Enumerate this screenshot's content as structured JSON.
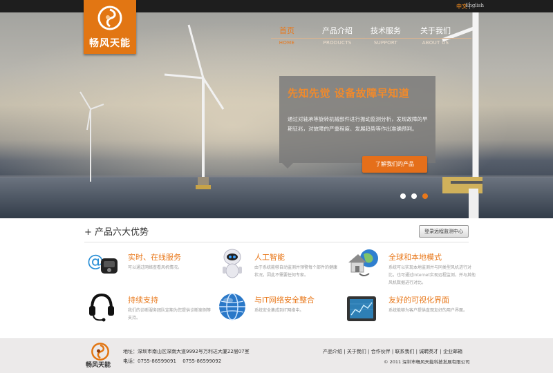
{
  "language": {
    "cn": "中文",
    "en": "English"
  },
  "logo": {
    "text": "畅风天能"
  },
  "nav": [
    {
      "cn": "首页",
      "en": "HOME",
      "active": true
    },
    {
      "cn": "产品介绍",
      "en": "PRODUCTS",
      "active": false
    },
    {
      "cn": "技术服务",
      "en": "SUPPORT",
      "active": false
    },
    {
      "cn": "关于我们",
      "en": "ABOUT US",
      "active": false
    }
  ],
  "banner": {
    "title": "先知先觉  设备故障早知道",
    "body": "通过对轴承等旋转机械部件进行振动监测分析，发现故障的早期征兆，对故障的严重程度、发展趋势等作出准确预判。",
    "button": "了解我们的产品",
    "slides_count": 3,
    "active_slide": 3
  },
  "advantages": {
    "heading": "+ 产品六大优势",
    "login_button": "登录远程监测中心",
    "items": [
      {
        "icon": "phone-at-icon",
        "title": "实时、在线服务",
        "desc": "可以通过网络查看风机情况。"
      },
      {
        "icon": "robot-icon",
        "title": "人工智能",
        "desc": "由于系统能够自动监测并预警每个部件的健康状况，因此不需要任何专家。"
      },
      {
        "icon": "house-globe-icon",
        "title": "全球和本地模式",
        "desc": "系统可以实现本地监测并与同类型风机进行对比，也可通过Internet实现远程监测，并与其他风机数据进行对比。"
      },
      {
        "icon": "headset-icon",
        "title": "持续支持",
        "desc": "我们的诊断服务团队定期为您提供诊断案例等支持。"
      },
      {
        "icon": "globe-icon",
        "title": "与IT网络安全整合",
        "desc": "系统安全集成到IT网络中。"
      },
      {
        "icon": "monitor-icon",
        "title": "友好的可视化界面",
        "desc": "系统能够为客户提供直观友好的用户界面。"
      }
    ]
  },
  "footer": {
    "logo_text": "畅风天能",
    "address": "地址：深圳市南山区深南大道9992号万利达大厦22层07室",
    "tel": "电话：0755-86599091　 0755-86599092",
    "links": [
      "产品介绍",
      "关于我们",
      "合作伙伴",
      "联系我们",
      "诚聘英才",
      "企业邮箱"
    ],
    "copyright": "© 2011  深圳市畅风天能科技发展有限公司"
  },
  "colors": {
    "accent": "#e8781b",
    "logo_bg": "#e27613",
    "topbar": "#1e1e1e"
  }
}
